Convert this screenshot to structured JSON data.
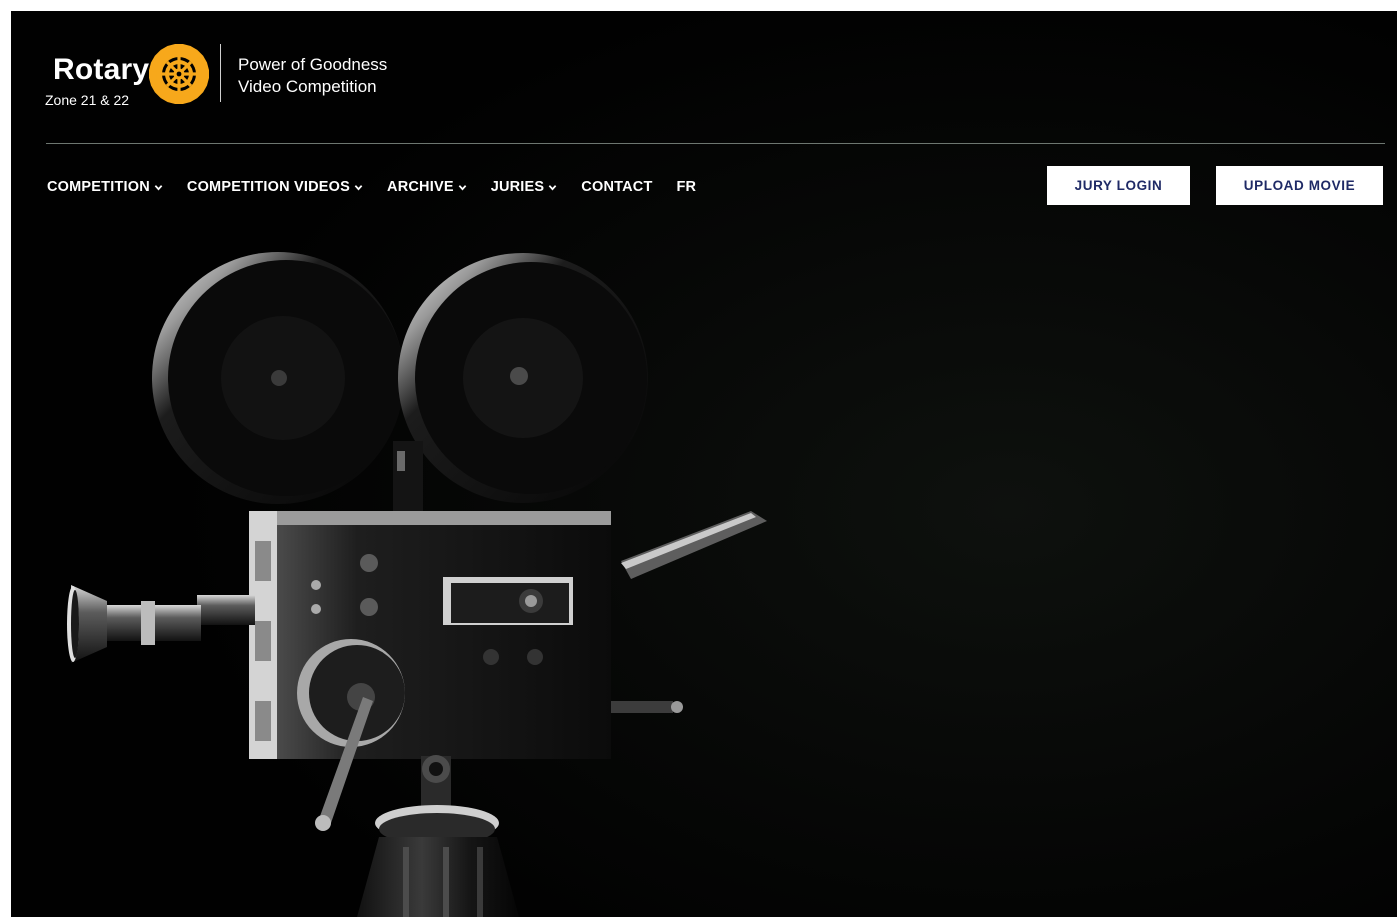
{
  "brand": {
    "name": "Rotary",
    "zone": "Zone 21 & 22",
    "tagline_line1": "Power of Goodness",
    "tagline_line2": "Video Competition",
    "gear_color": "#F7A81B"
  },
  "nav": {
    "items": [
      {
        "label": "COMPETITION",
        "dropdown": true
      },
      {
        "label": "COMPETITION VIDEOS",
        "dropdown": true
      },
      {
        "label": "ARCHIVE",
        "dropdown": true
      },
      {
        "label": "JURIES",
        "dropdown": true
      },
      {
        "label": "CONTACT",
        "dropdown": false
      },
      {
        "label": "FR",
        "dropdown": false
      }
    ]
  },
  "actions": {
    "jury_login": "JURY LOGIN",
    "upload_movie": "UPLOAD MOVIE"
  },
  "hero": {
    "image": "vintage-film-camera",
    "background_color": "#020202"
  },
  "colors": {
    "button_text": "#1F2A66",
    "nav_text": "#FFFFFF"
  }
}
